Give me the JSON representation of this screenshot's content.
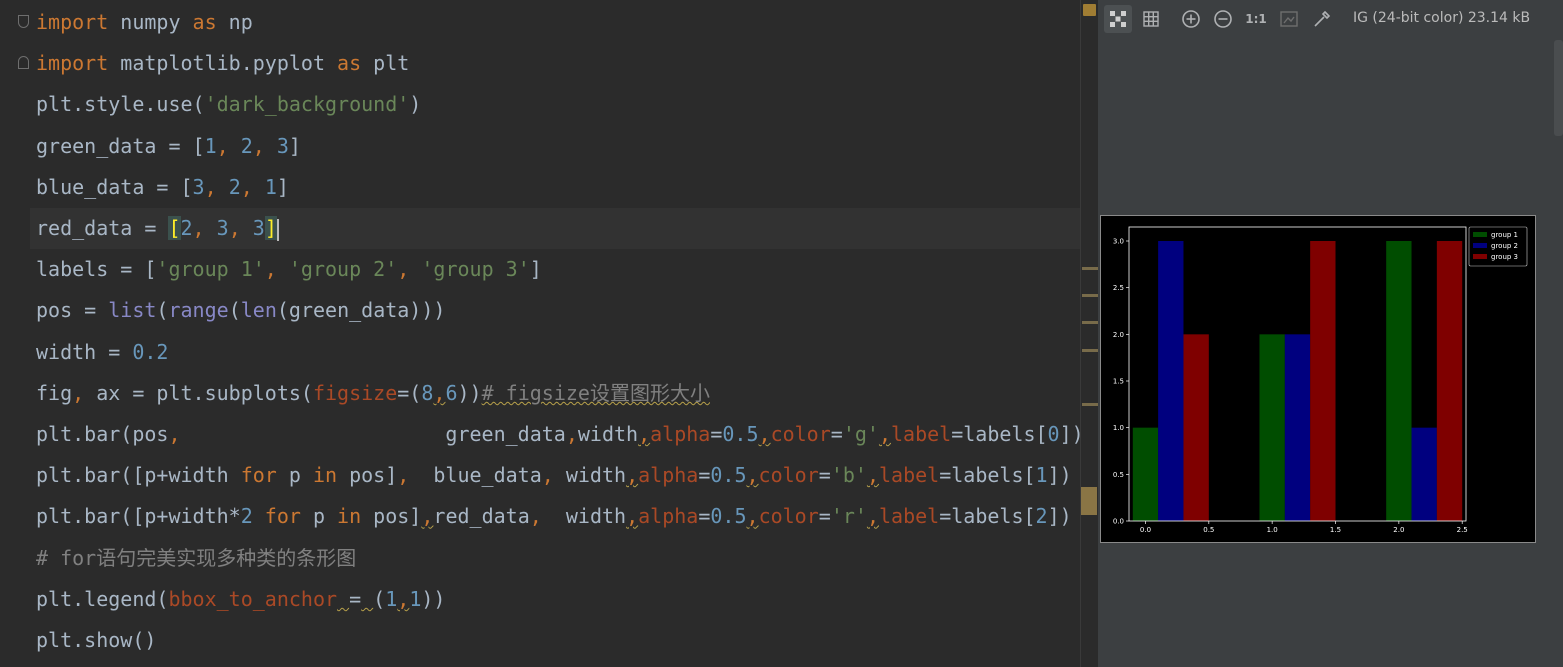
{
  "editor": {
    "lines": [
      [
        {
          "t": "import",
          "c": "kw"
        },
        {
          "t": " numpy "
        },
        {
          "t": "as",
          "c": "kw"
        },
        {
          "t": " np"
        }
      ],
      [
        {
          "t": "import",
          "c": "kw"
        },
        {
          "t": " matplotlib.pyplot "
        },
        {
          "t": "as",
          "c": "kw"
        },
        {
          "t": " plt"
        }
      ],
      [
        {
          "t": "plt.style.use("
        },
        {
          "t": "'dark_background'",
          "c": "str"
        },
        {
          "t": ")"
        }
      ],
      [
        {
          "t": "green_data = ["
        },
        {
          "t": "1",
          "c": "num"
        },
        {
          "t": ", ",
          "c": "kw"
        },
        {
          "t": "2",
          "c": "num"
        },
        {
          "t": ", ",
          "c": "kw"
        },
        {
          "t": "3",
          "c": "num"
        },
        {
          "t": "]"
        }
      ],
      [
        {
          "t": "blue_data = ["
        },
        {
          "t": "3",
          "c": "num"
        },
        {
          "t": ", ",
          "c": "kw"
        },
        {
          "t": "2",
          "c": "num"
        },
        {
          "t": ", ",
          "c": "kw"
        },
        {
          "t": "1",
          "c": "num"
        },
        {
          "t": "]"
        }
      ],
      [
        {
          "t": "red_data = "
        },
        {
          "t": "[",
          "c": "bracket-hl"
        },
        {
          "t": "2",
          "c": "num"
        },
        {
          "t": ", ",
          "c": "kw"
        },
        {
          "t": "3",
          "c": "num"
        },
        {
          "t": ", ",
          "c": "kw"
        },
        {
          "t": "3",
          "c": "num"
        },
        {
          "t": "]",
          "c": "bracket-hl"
        },
        {
          "caret": true
        }
      ],
      [
        {
          "t": "labels = ["
        },
        {
          "t": "'group 1'",
          "c": "str"
        },
        {
          "t": ", ",
          "c": "kw"
        },
        {
          "t": "'group 2'",
          "c": "str"
        },
        {
          "t": ", ",
          "c": "kw"
        },
        {
          "t": "'group 3'",
          "c": "str"
        },
        {
          "t": "]"
        }
      ],
      [
        {
          "t": "pos = "
        },
        {
          "t": "list",
          "c": "builtin"
        },
        {
          "t": "("
        },
        {
          "t": "range",
          "c": "builtin"
        },
        {
          "t": "("
        },
        {
          "t": "len",
          "c": "builtin"
        },
        {
          "t": "(green_data)))"
        }
      ],
      [
        {
          "t": "width = "
        },
        {
          "t": "0.2",
          "c": "num"
        }
      ],
      [
        {
          "t": "fig"
        },
        {
          "t": ", ",
          "c": "kw"
        },
        {
          "t": "ax = plt.subplots("
        },
        {
          "t": "figsize",
          "c": "param"
        },
        {
          "t": "=("
        },
        {
          "t": "8",
          "c": "num"
        },
        {
          "t": ",",
          "c": "kw warn"
        },
        {
          "t": "6",
          "c": "num"
        },
        {
          "t": "))"
        },
        {
          "t": "# figsize设置图形大小",
          "c": "comment warn"
        }
      ],
      [
        {
          "t": "plt.bar(pos"
        },
        {
          "t": ",",
          "c": "kw"
        },
        {
          "t": "                      green_data"
        },
        {
          "t": ",",
          "c": "kw"
        },
        {
          "t": "width"
        },
        {
          "t": ",",
          "c": "kw warn"
        },
        {
          "t": "alpha",
          "c": "param"
        },
        {
          "t": "="
        },
        {
          "t": "0.5",
          "c": "num"
        },
        {
          "t": ",",
          "c": "kw warn"
        },
        {
          "t": "color",
          "c": "param"
        },
        {
          "t": "="
        },
        {
          "t": "'g'",
          "c": "str"
        },
        {
          "t": ",",
          "c": "kw warn"
        },
        {
          "t": "label",
          "c": "param"
        },
        {
          "t": "=labels["
        },
        {
          "t": "0",
          "c": "num"
        },
        {
          "t": "])"
        }
      ],
      [
        {
          "t": "plt.bar([p+width "
        },
        {
          "t": "for",
          "c": "kw"
        },
        {
          "t": " p "
        },
        {
          "t": "in",
          "c": "kw"
        },
        {
          "t": " pos]"
        },
        {
          "t": ",",
          "c": "kw"
        },
        {
          "t": "  blue_data"
        },
        {
          "t": ",",
          "c": "kw"
        },
        {
          "t": " width"
        },
        {
          "t": ",",
          "c": "kw warn"
        },
        {
          "t": "alpha",
          "c": "param"
        },
        {
          "t": "="
        },
        {
          "t": "0.5",
          "c": "num"
        },
        {
          "t": ",",
          "c": "kw warn"
        },
        {
          "t": "color",
          "c": "param"
        },
        {
          "t": "="
        },
        {
          "t": "'b'",
          "c": "str"
        },
        {
          "t": ",",
          "c": "kw warn"
        },
        {
          "t": "label",
          "c": "param"
        },
        {
          "t": "=labels["
        },
        {
          "t": "1",
          "c": "num"
        },
        {
          "t": "])"
        }
      ],
      [
        {
          "t": "plt.bar([p+width*"
        },
        {
          "t": "2",
          "c": "num"
        },
        {
          "t": " "
        },
        {
          "t": "for",
          "c": "kw"
        },
        {
          "t": " p "
        },
        {
          "t": "in",
          "c": "kw"
        },
        {
          "t": " pos]"
        },
        {
          "t": ",",
          "c": "kw warn"
        },
        {
          "t": "red_data"
        },
        {
          "t": ",",
          "c": "kw"
        },
        {
          "t": "  width"
        },
        {
          "t": ",",
          "c": "kw warn"
        },
        {
          "t": "alpha",
          "c": "param"
        },
        {
          "t": "="
        },
        {
          "t": "0.5",
          "c": "num"
        },
        {
          "t": ",",
          "c": "kw warn"
        },
        {
          "t": "color",
          "c": "param"
        },
        {
          "t": "="
        },
        {
          "t": "'r'",
          "c": "str"
        },
        {
          "t": ",",
          "c": "kw warn"
        },
        {
          "t": "label",
          "c": "param"
        },
        {
          "t": "=labels["
        },
        {
          "t": "2",
          "c": "num"
        },
        {
          "t": "])"
        }
      ],
      [
        {
          "t": "# for语句完美实现多种类的条形图",
          "c": "comment"
        }
      ],
      [
        {
          "t": "plt.legend("
        },
        {
          "t": "bbox_to_anchor",
          "c": "param"
        },
        {
          "t": " ",
          "c": "warn"
        },
        {
          "t": "="
        },
        {
          "t": " ",
          "c": "warn"
        },
        {
          "t": "("
        },
        {
          "t": "1",
          "c": "num"
        },
        {
          "t": ",",
          "c": "kw warn"
        },
        {
          "t": "1",
          "c": "num"
        },
        {
          "t": "))"
        }
      ],
      [
        {
          "t": "plt.show()"
        }
      ]
    ],
    "current_line": 5
  },
  "viewer": {
    "info": "IG (24-bit color) 23.14 kB",
    "zoom_actual_label": "1:1",
    "icons": [
      "checkerboard-icon",
      "grid-icon",
      "zoom-in-icon",
      "zoom-out-icon",
      "actual-size-icon",
      "fit-image-icon",
      "color-picker-icon"
    ]
  },
  "chart_data": {
    "type": "bar",
    "title": "",
    "xlabel": "",
    "ylabel": "",
    "x_ticks": [
      "0.0",
      "0.5",
      "1.0",
      "1.5",
      "2.0",
      "2.5"
    ],
    "y_ticks": [
      "0.0",
      "0.5",
      "1.0",
      "1.5",
      "2.0",
      "2.5",
      "3.0"
    ],
    "xlim": [
      -0.13,
      2.53
    ],
    "ylim": [
      0,
      3.15
    ],
    "bar_width": 0.2,
    "legend_position": "top-right outside",
    "series": [
      {
        "name": "group 1",
        "color": "#004d00",
        "x": [
          0,
          1,
          2
        ],
        "values": [
          1,
          2,
          3
        ]
      },
      {
        "name": "group 2",
        "color": "#00007f",
        "x": [
          0.2,
          1.2,
          2.2
        ],
        "values": [
          3,
          2,
          1
        ]
      },
      {
        "name": "group 3",
        "color": "#7f0000",
        "x": [
          0.4,
          1.4,
          2.4
        ],
        "values": [
          2,
          3,
          3
        ]
      }
    ]
  }
}
